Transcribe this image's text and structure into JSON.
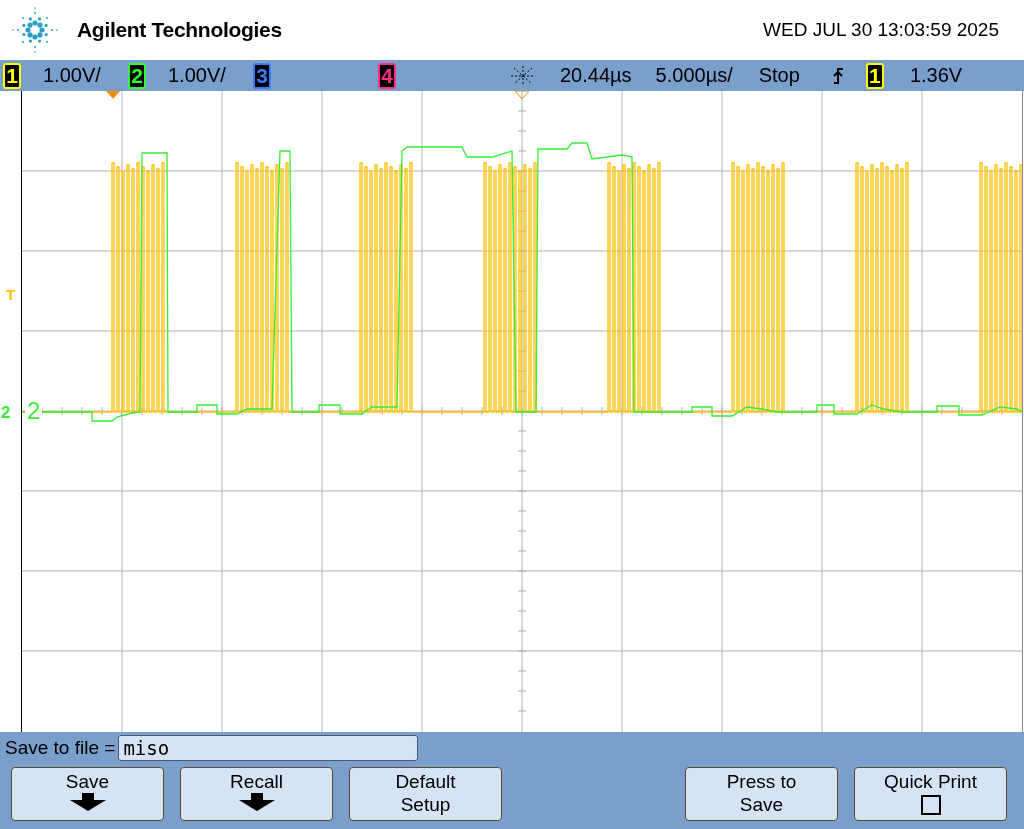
{
  "header": {
    "brand": "Agilent Technologies",
    "datetime": "WED JUL 30 13:03:59 2025"
  },
  "status_bar": {
    "channels": [
      {
        "number": "1",
        "scale": "1.00V/",
        "color": "#ffff00"
      },
      {
        "number": "2",
        "scale": "1.00V/",
        "color": "#33ff33"
      },
      {
        "number": "3",
        "color": "#3a7bff"
      },
      {
        "number": "4",
        "color": "#ff2d8a"
      }
    ],
    "delay": "20.44µs",
    "timebase": "5.000µs/",
    "run_state": "Stop",
    "trigger_channel": {
      "number": "1",
      "color": "#ffff00"
    },
    "trigger_level": "1.36V"
  },
  "graticule": {
    "trigger_marker": "T",
    "ground_marker": "2",
    "trace_label": "2"
  },
  "save_bar": {
    "label": "Save to file =",
    "value": "miso"
  },
  "softkeys": [
    {
      "kind": "arrow",
      "label": "Save"
    },
    {
      "kind": "arrow",
      "label": "Recall"
    },
    {
      "kind": "plain",
      "label": "Default Setup"
    },
    {
      "kind": "blank"
    },
    {
      "kind": "plain",
      "label": "Press to Save"
    },
    {
      "kind": "checkbox",
      "label": "Quick Print",
      "checked": false
    }
  ]
}
